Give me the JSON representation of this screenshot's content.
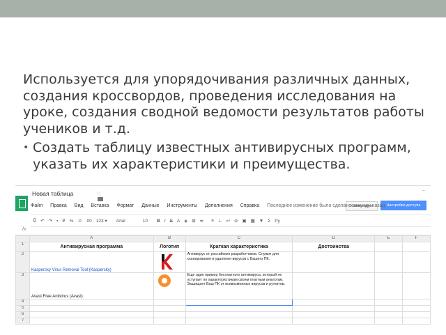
{
  "slide": {
    "paragraph": "Используется для упорядочивания различных данных, создания кроссвордов, проведения исследования на уроке, создания сводной ведомости результатов работы учеников и т.д.",
    "bullet": "Создать таблицу известных антивирусных программ, указать их характеристики и преимущества."
  },
  "sheets": {
    "title": "Новая таблица",
    "header_right": "...",
    "comments_label": "Комментарии",
    "share_label": "Настройки доступа",
    "menu": [
      "Файл",
      "Правка",
      "Вид",
      "Вставка",
      "Формат",
      "Данные",
      "Инструменты",
      "Дополнения",
      "Справка",
      "Последнее изменение было сделано секунду назад"
    ],
    "toolbar": {
      "currency": "₽",
      "percent": "%",
      "decimals_less": ".0",
      "decimals_more": ".00",
      "number_format": "123 ▾",
      "font": "Arial",
      "font_size": "10",
      "bold": "B",
      "italic": "I",
      "strike": "S",
      "text_color": "A",
      "sum": "Σ"
    },
    "fx": "fx",
    "columns": [
      "A",
      "B",
      "C",
      "D",
      "E",
      "F"
    ],
    "rows": [
      "1",
      "2",
      "3",
      "4",
      "5",
      "6",
      "7"
    ],
    "headers": {
      "a": "Антивирусная программа",
      "b": "Логотип",
      "c": "Краткая характеристика",
      "d": "Достоинства"
    },
    "row2": {
      "a": "Kaspersky Virus Removal Tool (Kaspersky)",
      "c": "Антивирус от российских разработчиков. Служит для сканирования и удаления вирусов с Вашего ПК."
    },
    "row3": {
      "a": "Avast Free Antivirus (Avast)",
      "c": "Еще один пример бесплатного антивируса, который не уступает по характеристикам своим платным аналогам. Защищает Ваш ПК от всевозможных вирусов и руткитов."
    }
  }
}
